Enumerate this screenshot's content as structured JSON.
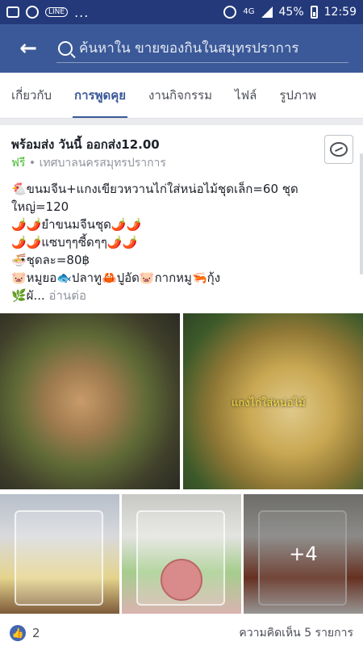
{
  "status_bar": {
    "network": "4G",
    "battery": "45%",
    "time": "12:59",
    "line_badge": "LINE",
    "dots": "..."
  },
  "header": {
    "search_value": "ค้นหาใน ขายของกินในสมุทรปราการ"
  },
  "tabs": [
    {
      "label": "เกี่ยวกับ"
    },
    {
      "label": "การพูดคุย"
    },
    {
      "label": "งานกิจกรรม"
    },
    {
      "label": "ไฟล์"
    },
    {
      "label": "รูปภาพ"
    }
  ],
  "post": {
    "title": "พร้อมส่ง วันนี้ ออกส่ง12.00",
    "price_label": "ฟรี",
    "separator": " • ",
    "location": "เทศบาลนครสมุทรปราการ",
    "body_lines": [
      "🐔ขนมจีน+แกงเขียวหวานไก่ใส่หน่อไม้ชุดเล็ก=60 ชุด",
      "ใหญ่=120",
      "🌶️🌶️ยำขนมจีนชุด🌶️🌶️",
      "🌶️🌶️แซบๆๆซี้ดๆๆ🌶️🌶️",
      "🍜ชุดละ=80฿",
      "🐷หมูยอ🐟ปลาทู🦀ปูอัด🐷กากหมู🦐กุ้ง",
      "🌿ผั..."
    ],
    "read_more": " อ่านต่อ",
    "photo_caption": "แกงไก่ใส่หน่อไม้",
    "more_photos": "+4",
    "like_count": "2",
    "comments": "ความคิดเห็น 5 รายการ"
  },
  "colors": {
    "header_bg": "#3b5998",
    "status_bg": "#23397a",
    "accent": "#3b5998",
    "free_green": "#42b72a"
  },
  "icons": {
    "back": "arrow-left-icon",
    "search": "search-icon",
    "messenger": "messenger-icon",
    "like": "thumbs-up-icon"
  }
}
